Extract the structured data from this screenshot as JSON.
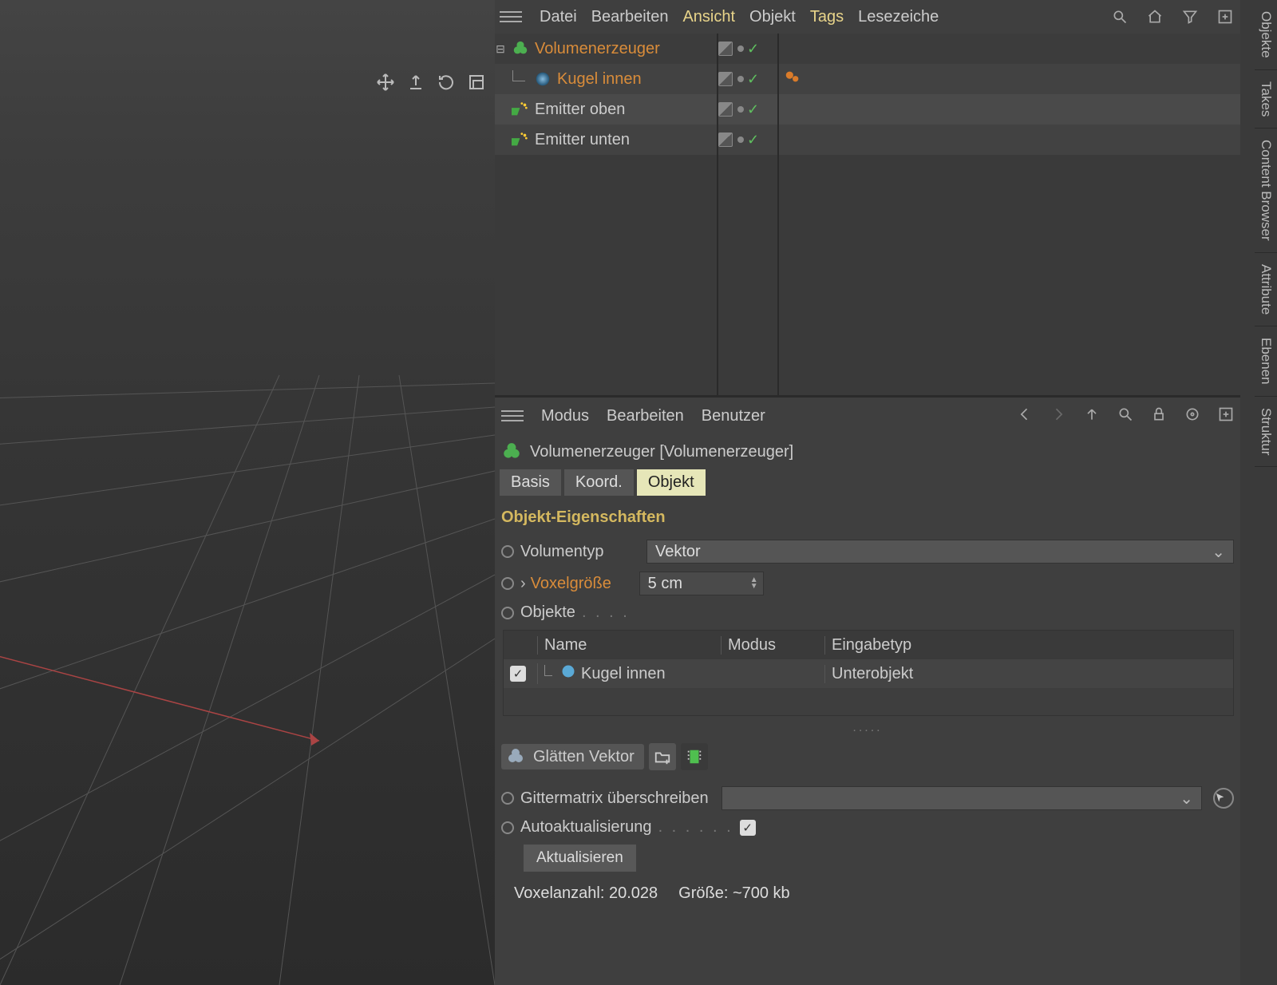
{
  "object_manager": {
    "menu": {
      "datei": "Datei",
      "bearbeiten": "Bearbeiten",
      "ansicht": "Ansicht",
      "objekt": "Objekt",
      "tags": "Tags",
      "lesezeiche": "Lesezeiche"
    },
    "tree": [
      {
        "label": "Volumenerzeuger",
        "selected": true,
        "icon": "volume"
      },
      {
        "label": "Kugel innen",
        "selected": true,
        "icon": "sphere",
        "child": true,
        "extra_tag": true
      },
      {
        "label": "Emitter oben",
        "selected": false,
        "icon": "emitter"
      },
      {
        "label": "Emitter unten",
        "selected": false,
        "icon": "emitter"
      }
    ]
  },
  "attribute_manager": {
    "menu": {
      "modus": "Modus",
      "bearbeiten": "Bearbeiten",
      "benutzer": "Benutzer"
    },
    "title": "Volumenerzeuger [Volumenerzeuger]",
    "tabs": {
      "basis": "Basis",
      "koord": "Koord.",
      "objekt": "Objekt"
    },
    "section_title": "Objekt-Eigenschaften",
    "volumentyp": {
      "label": "Volumentyp",
      "value": "Vektor"
    },
    "voxelgroesse": {
      "label": "Voxelgröße",
      "value": "5 cm"
    },
    "objekte": {
      "label": "Objekte"
    },
    "table": {
      "headers": {
        "name": "Name",
        "modus": "Modus",
        "eingabetyp": "Eingabetyp"
      },
      "row": {
        "name": "Kugel innen",
        "eingabetyp": "Unterobjekt"
      }
    },
    "smooth_vector": "Glätten Vektor",
    "gittermatrix": {
      "label": "Gittermatrix überschreiben"
    },
    "autoaktualisierung": {
      "label": "Autoaktualisierung"
    },
    "aktualisieren_btn": "Aktualisieren",
    "stats": {
      "voxels": "Voxelanzahl: 20.028",
      "size": "Größe: ~700 kb"
    }
  },
  "side_tabs": {
    "objekte": "Objekte",
    "takes": "Takes",
    "content_browser": "Content Browser",
    "attribute": "Attribute",
    "ebenen": "Ebenen",
    "struktur": "Struktur"
  }
}
